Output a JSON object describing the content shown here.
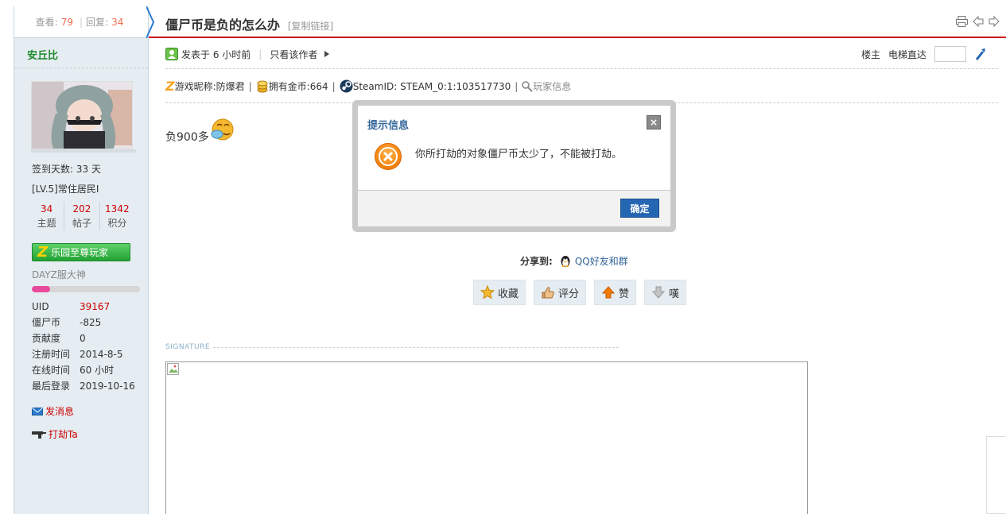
{
  "sidebar": {
    "views_label": "查看:",
    "views": "79",
    "replies_label": "回复:",
    "replies": "34",
    "author": "安丘比",
    "checkin": "签到天数: 33 天",
    "level": "[LV.5]常住居民I",
    "counts": [
      {
        "value": "34",
        "label": "主题"
      },
      {
        "value": "202",
        "label": "帖子"
      },
      {
        "value": "1342",
        "label": "积分"
      }
    ],
    "badge": "乐园至尊玩家",
    "rank": "DAYZ服大神",
    "rank_progress": 0.17,
    "info": [
      {
        "key": "UID",
        "value": "39167"
      },
      {
        "key": "僵尸币",
        "value": "-825"
      },
      {
        "key": "贡献度",
        "value": "0"
      },
      {
        "key": "注册时间",
        "value": "2014-8-5"
      },
      {
        "key": "在线时间",
        "value": "60 小时"
      },
      {
        "key": "最后登录",
        "value": "2019-10-16"
      }
    ],
    "send_msg": "发消息",
    "rob": "打劫Ta"
  },
  "header": {
    "title": "僵尸币是负的怎么办",
    "copy_link": "[复制链接]"
  },
  "meta": {
    "posted": "发表于 6 小时前",
    "only_author": "只看该作者",
    "floor": "楼主",
    "elevator": "电梯直达"
  },
  "gameinfo": {
    "nickname": "游戏昵称:防爆君",
    "coins": "拥有金币:664",
    "steam": "SteamID: STEAM_0:1:103517730",
    "player_info": "玩家信息"
  },
  "post": {
    "text": "负900多"
  },
  "share": {
    "label": "分享到:",
    "qq": "QQ好友和群"
  },
  "actions": [
    {
      "label": "收藏",
      "icon": "star-icon"
    },
    {
      "label": "评分",
      "icon": "thumb-icon"
    },
    {
      "label": "赞",
      "icon": "arrow-up-icon"
    },
    {
      "label": "嘆",
      "icon": "arrow-down-icon"
    }
  ],
  "signature_label": "SIGNATURE",
  "dialog": {
    "title": "提示信息",
    "message": "你所打劫的对象僵尸币太少了，不能被打劫。",
    "ok": "确定",
    "close": "×"
  }
}
